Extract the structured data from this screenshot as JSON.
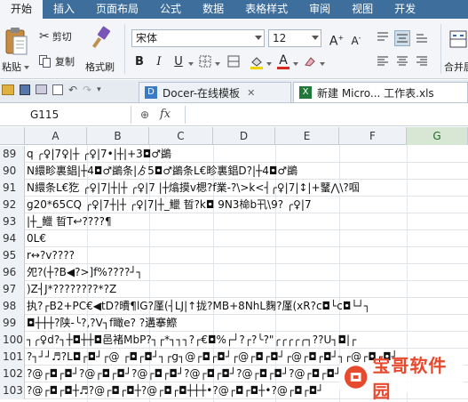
{
  "menu": {
    "items": [
      "开始",
      "插入",
      "页面布局",
      "公式",
      "数据",
      "表格样式",
      "审阅",
      "视图",
      "开发"
    ],
    "active_index": 0
  },
  "ribbon": {
    "paste_label": "粘贴",
    "cut_label": "剪切",
    "copy_label": "复制",
    "format_painter_label": "格式刷",
    "font_name": "宋体",
    "font_size": "12",
    "merge_label": "合并居"
  },
  "tabs": [
    {
      "label": "Docer-在线模板",
      "active": false
    },
    {
      "label": "新建 Micro... 工作表.xls",
      "active": true
    }
  ],
  "formula_bar": {
    "name_box": "G115",
    "fx_label": "fx",
    "formula": ""
  },
  "columns": [
    "A",
    "B",
    "C",
    "D",
    "E",
    "F",
    "G"
  ],
  "selected_column": "G",
  "rows": [
    {
      "num": "89",
      "text": "q                ╭♀|7♀|┼   ╭♀|7•|┼|+3◘♂鷁"
    },
    {
      "num": "90",
      "text": "N繯畛裏錩|┼4◘♂鷁条|ゟ5◘♂鷁条L€畛裏錩D?|┼4◘♂鷁"
    },
    {
      "num": "91",
      "text": "N繯条L€犵         ╭♀|7|┼|┼   ╭♀|7    |┼熻摸v楒?f業-?\\>k<┤╭♀|7|↕|+鼜⋀\\?啯"
    },
    {
      "num": "92",
      "text": "g20*65CQ          ╭♀|7┼|┼   ╭♀|7|┼_鱲 晢?k◘   9N3椧b卂\\9?    ╭♀|7"
    },
    {
      "num": "93",
      "text": "|┼_鱲 晢T↩????¶"
    },
    {
      "num": "94",
      "text": "0L€"
    },
    {
      "num": "95",
      "text": "r↔?v????"
    },
    {
      "num": "96",
      "text": "夗?(┼?B◀?>]f%????┘┐"
    },
    {
      "num": "97",
      "text": ")Z┤J*????????*?Z"
    },
    {
      "num": "98",
      "text": "执?┌B2+PC€◀tD?曊¶lG?厪(┤LJ|↑拢?MB+8NhL麴?厪(xR?c◘└c◘└┘┐"
    },
    {
      "num": "99",
      "text": "                ◘┼┼┼?陕-╰?,?V┐f瞰e? ?遘搴鰶"
    },
    {
      "num": "100",
      "text": "┐╭♀d?┐┼◘┼┼◘邑褚MbP?┐┌*┐┐┐?┌€◘%┌┘?┌?╰?\"╭╭╭╭╭┐??U┐◘|┌"
    },
    {
      "num": "101",
      "text": "?┐┘┘♬?L◘┌◘┘┌@ ┌◘┌◘┘┐┌g┐@┌◘┌◘┘┌@┌◘┌◘┘┌@┌◘┌◘┘┐┌@┌◘┌◘┘"
    },
    {
      "num": "102",
      "text": "                ?@┌◘┌◘┘?@┌◘┌◘┘?@┌◘┌◘┘?@┌◘┌◘┘?@┌◘┌◘┘?@┌◘┌◘┘"
    },
    {
      "num": "103",
      "text": "                ?@┌◘┌◘┼♬?@┌◘┌◘┼?@┌◘┌◘┼┼┼•?@┌◘┌◘┼•?@┌◘┌◘┘"
    }
  ],
  "watermark": {
    "text": "宝哥软件园"
  },
  "colors": {
    "menubar": "#3e6e9c",
    "selected_column_header": "#d7e7d3",
    "watermark_text": "#e64a2e"
  }
}
